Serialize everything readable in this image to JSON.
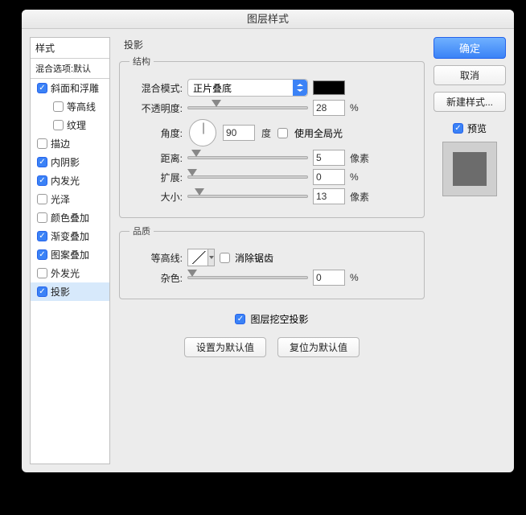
{
  "title": "图层样式",
  "sidebar": {
    "header": "样式",
    "blending": "混合选项:默认",
    "items": [
      {
        "label": "斜面和浮雕",
        "checked": true
      },
      {
        "label": "等高线",
        "checked": false,
        "nested": true
      },
      {
        "label": "纹理",
        "checked": false,
        "nested": true
      },
      {
        "label": "描边",
        "checked": false
      },
      {
        "label": "内阴影",
        "checked": true
      },
      {
        "label": "内发光",
        "checked": true
      },
      {
        "label": "光泽",
        "checked": false
      },
      {
        "label": "颜色叠加",
        "checked": false
      },
      {
        "label": "渐变叠加",
        "checked": true
      },
      {
        "label": "图案叠加",
        "checked": true
      },
      {
        "label": "外发光",
        "checked": false
      },
      {
        "label": "投影",
        "checked": true,
        "selected": true
      }
    ]
  },
  "main": {
    "heading": "投影",
    "structure": {
      "legend": "结构",
      "blendmode_label": "混合模式:",
      "blendmode_value": "正片叠底",
      "color": "#000000",
      "opacity_label": "不透明度:",
      "opacity_value": "28",
      "opacity_unit": "%",
      "angle_label": "角度:",
      "angle_value": "90",
      "angle_unit": "度",
      "global_light_label": "使用全局光",
      "global_light_checked": false,
      "distance_label": "距离:",
      "distance_value": "5",
      "distance_unit": "像素",
      "spread_label": "扩展:",
      "spread_value": "0",
      "spread_unit": "%",
      "size_label": "大小:",
      "size_value": "13",
      "size_unit": "像素"
    },
    "quality": {
      "legend": "品质",
      "contour_label": "等高线:",
      "antialias_label": "消除锯齿",
      "antialias_checked": false,
      "noise_label": "杂色:",
      "noise_value": "0",
      "noise_unit": "%"
    },
    "knockout": {
      "label": "图层挖空投影",
      "checked": true
    },
    "buttons": {
      "default": "设置为默认值",
      "reset": "复位为默认值"
    }
  },
  "right": {
    "ok": "确定",
    "cancel": "取消",
    "newstyle": "新建样式...",
    "preview_label": "预览",
    "preview_checked": true
  }
}
